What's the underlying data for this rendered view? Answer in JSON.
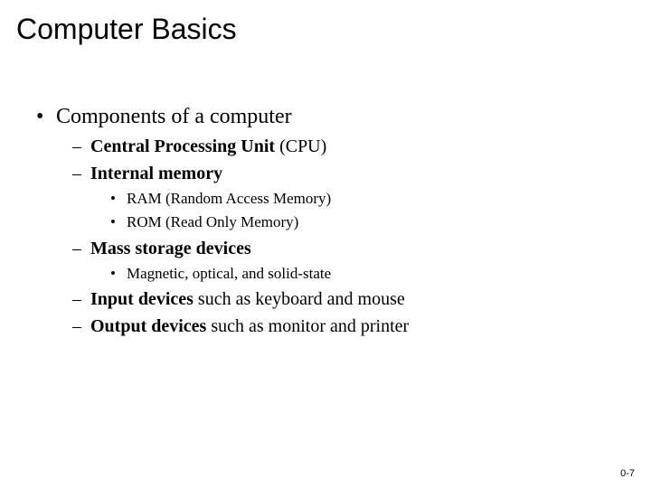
{
  "title": "Computer Basics",
  "lvl1": {
    "text": "Components of a computer"
  },
  "lvl2": {
    "a": {
      "bold": "Central Processing Unit",
      "rest": " (CPU)"
    },
    "b": {
      "bold": "Internal memory",
      "rest": ""
    },
    "c": {
      "bold": "Mass storage devices",
      "rest": ""
    },
    "d": {
      "bold": "Input devices",
      "rest": " such as keyboard and mouse"
    },
    "e": {
      "bold": "Output devices",
      "rest": " such as monitor and printer"
    }
  },
  "lvl3": {
    "a": "RAM (Random Access Memory)",
    "b": "ROM (Read Only Memory)",
    "c": "Magnetic, optical, and solid-state"
  },
  "bullets": {
    "l1": "•",
    "l2": "–",
    "l3": "•"
  },
  "pagenum": "0-7"
}
